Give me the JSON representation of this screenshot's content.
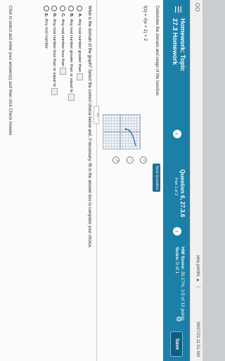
{
  "topbar": {
    "window_controls": "OO",
    "user": "sina portillo",
    "datetime": "08/07/21 11:51 AM"
  },
  "header": {
    "menu_icon": "hamburger-menu-icon",
    "assignment_title": "Homework: Topic",
    "assignment_subtitle": "27.3 Homework",
    "question_label": "Question 6, 27.3.6",
    "question_part": "Part 1 of 2",
    "hw_score_label": "HW Score:",
    "hw_score_value": "29.17%, 3.5 of 12 points",
    "score_label": "Score:",
    "score_value": "0 of 1",
    "save_label": "Save"
  },
  "problem": {
    "instruction": "Determine the domain and range of the function.",
    "function": "f(x) = √(x + 1) + 2",
    "next_question_label": "Next Question"
  },
  "graph": {
    "icons": [
      "zoom-in-icon",
      "zoom-out-icon",
      "expand-icon"
    ]
  },
  "question": {
    "prompt": "What is the domain of the graph? Select the correct choice below and, if necessary, fill in the answer box to complete your choice.",
    "choices": [
      {
        "letter": "A.",
        "text": "Any real number greater than"
      },
      {
        "letter": "B.",
        "text": "Any real number greater than or equal to"
      },
      {
        "letter": "C.",
        "text": "Any real number less than"
      },
      {
        "letter": "D.",
        "text": "Any real number less than or equal to"
      },
      {
        "letter": "E.",
        "text": "Any real number"
      }
    ]
  },
  "footer": {
    "help_text": "Click to select and enter your answer(s) and then click Check Answer."
  },
  "colors": {
    "header_blue": "#1b7fa7",
    "save_button": "#0e5e83"
  }
}
